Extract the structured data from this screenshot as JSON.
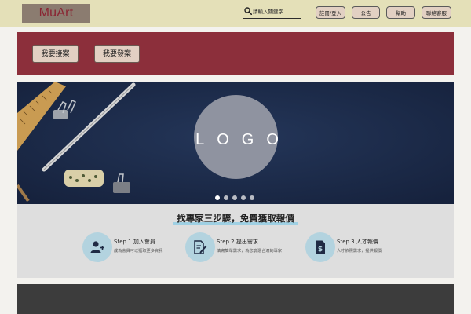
{
  "header": {
    "logo": "MuArt",
    "search_placeholder": "請輸入關鍵字...",
    "nav": [
      "註冊/登入",
      "公告",
      "幫助",
      "聯絡客服"
    ]
  },
  "hero": {
    "buttons": [
      "我要接案",
      "我要發案"
    ]
  },
  "banner": {
    "logo_text": "LOGO",
    "slide_count": 5,
    "active_slide": 0
  },
  "steps": {
    "title": "找專家三步驟，免費獲取報價",
    "items": [
      {
        "title": "Step.1 加入會員",
        "desc": "成為會員可以獲取更多資訊",
        "icon": "user-add-icon"
      },
      {
        "title": "Step.2 提出需求",
        "desc": "填寫簡單需求，為您篩選合適的專家",
        "icon": "edit-document-icon"
      },
      {
        "title": "Step.3 人才報價",
        "desc": "人才依照需求，提供報價",
        "icon": "quote-document-icon"
      }
    ]
  },
  "colors": {
    "topbar": "#e4e0b8",
    "accent_red": "#8c2f3b",
    "banner_navy": "#1b2a48",
    "button_bg": "#e2d0c3",
    "step_icon_bg": "#b3d3df"
  }
}
